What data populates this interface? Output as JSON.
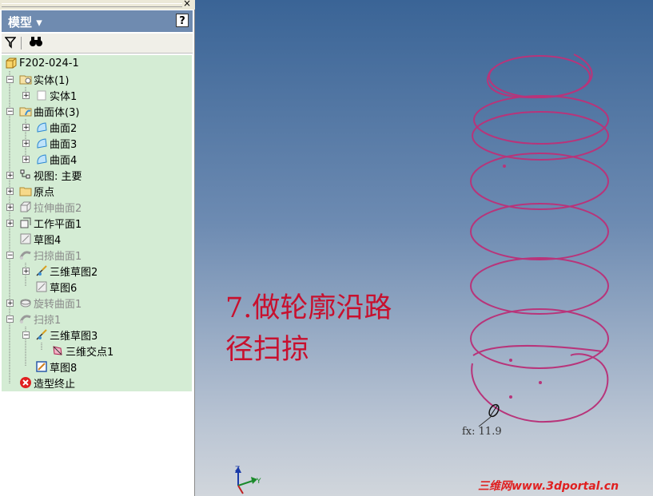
{
  "panel": {
    "header_title": "模型 ▾",
    "help_label": "?",
    "close_label": "×"
  },
  "tree": [
    {
      "label": "F202-024-1",
      "icon": "part-icon",
      "gray": false
    },
    {
      "label": "实体(1)",
      "icon": "solid-bodies-icon",
      "gray": false
    },
    {
      "label": "实体1",
      "icon": "solid-body-icon",
      "gray": false
    },
    {
      "label": "曲面体(3)",
      "icon": "surface-bodies-icon",
      "gray": false
    },
    {
      "label": "曲面2",
      "icon": "surface-icon",
      "gray": false
    },
    {
      "label": "曲面3",
      "icon": "surface-icon",
      "gray": false
    },
    {
      "label": "曲面4",
      "icon": "surface-icon",
      "gray": false
    },
    {
      "label": "视图: 主要",
      "icon": "view-icon",
      "gray": false
    },
    {
      "label": "原点",
      "icon": "folder-icon",
      "gray": false
    },
    {
      "label": "拉伸曲面2",
      "icon": "extrude-icon",
      "gray": true
    },
    {
      "label": "工作平面1",
      "icon": "work-plane-icon",
      "gray": false
    },
    {
      "label": "草图4",
      "icon": "sketch-icon",
      "gray": false
    },
    {
      "label": "扫掠曲面1",
      "icon": "sweep-surface-icon",
      "gray": true
    },
    {
      "label": "三维草图2",
      "icon": "3d-sketch-icon",
      "gray": false
    },
    {
      "label": "草图6",
      "icon": "sketch-icon",
      "gray": false
    },
    {
      "label": "旋转曲面1",
      "icon": "revolve-icon",
      "gray": true
    },
    {
      "label": "扫掠1",
      "icon": "sweep-icon",
      "gray": true
    },
    {
      "label": "三维草图3",
      "icon": "3d-sketch-icon",
      "gray": false
    },
    {
      "label": "三维交点1",
      "icon": "intersection-icon",
      "gray": false
    },
    {
      "label": "草图8",
      "icon": "sketch-active-icon",
      "gray": false
    },
    {
      "label": "造型终止",
      "icon": "end-of-part-icon",
      "gray": false
    }
  ],
  "viewport": {
    "annotation_line1": "7.做轮廓沿路",
    "annotation_line2": "径扫掠",
    "dimension_label": "fx: 11.9",
    "axis_z": "Z",
    "axis_y": "Y",
    "watermark": "三维网www.3dportal.cn"
  },
  "colors": {
    "header_bg": "#6f8bb0",
    "tree_bg": "#d4ecd4",
    "helix": "#b8347a",
    "annotation": "#c8102e"
  }
}
